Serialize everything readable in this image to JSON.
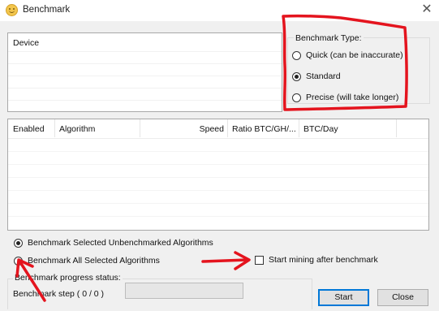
{
  "window": {
    "title": "Benchmark",
    "icon": "smiley-icon",
    "close_icon": "close-icon"
  },
  "device_panel": {
    "header": "Device"
  },
  "benchmark_type": {
    "legend": "Benchmark Type:",
    "options": [
      {
        "label": "Quick (can be inaccurate)",
        "checked": false
      },
      {
        "label": "Standard",
        "checked": true
      },
      {
        "label": "Precise (will take longer)",
        "checked": false
      }
    ]
  },
  "algorithms_table": {
    "columns": [
      "Enabled",
      "Algorithm",
      "Speed",
      "Ratio BTC/GH/...",
      "BTC/Day"
    ],
    "rows": []
  },
  "selection": {
    "options": [
      {
        "label": "Benchmark Selected Unbenchmarked Algorithms",
        "checked": true
      },
      {
        "label": "Benchmark All Selected Algorithms",
        "checked": false
      }
    ]
  },
  "start_mining_checkbox": {
    "label": "Start mining after benchmark",
    "checked": false
  },
  "progress": {
    "legend": "Benchmark progress status:",
    "step_text": "Benchmark step ( 0 / 0 )",
    "fraction": 0
  },
  "buttons": {
    "start": "Start",
    "close": "Close"
  },
  "colors": {
    "annotation": "#e4141e",
    "progress": "#06b025",
    "default_button_border": "#0078d7"
  }
}
